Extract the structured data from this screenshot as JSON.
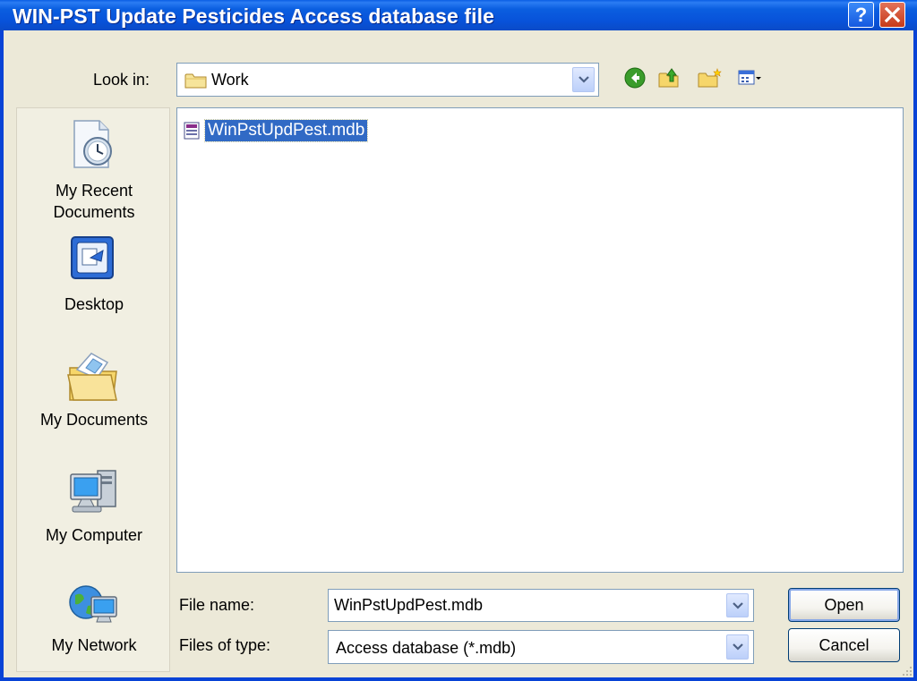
{
  "window": {
    "title": "WIN-PST Update Pesticides Access database file",
    "help_symbol": "?"
  },
  "look_in": {
    "label": "Look in:",
    "value": "Work"
  },
  "toolbar": {
    "icons": [
      "back-icon",
      "up-folder-icon",
      "new-folder-icon",
      "views-menu-icon"
    ]
  },
  "places_bar": {
    "items": [
      {
        "label_line1": "My Recent",
        "label_line2": "Documents",
        "icon": "recent-documents-icon"
      },
      {
        "label_line1": "Desktop",
        "label_line2": "",
        "icon": "desktop-icon"
      },
      {
        "label_line1": "My Documents",
        "label_line2": "",
        "icon": "my-documents-icon"
      },
      {
        "label_line1": "My Computer",
        "label_line2": "",
        "icon": "my-computer-icon"
      },
      {
        "label_line1": "My Network",
        "label_line2": "",
        "icon": "my-network-icon"
      }
    ]
  },
  "file_list": {
    "items": [
      {
        "name": "WinPstUpdPest.mdb",
        "selected": true,
        "icon": "access-database-icon"
      }
    ]
  },
  "file_name": {
    "label": "File name:",
    "value": "WinPstUpdPest.mdb"
  },
  "file_type": {
    "label": "Files of type:",
    "value": "Access database (*.mdb)"
  },
  "buttons": {
    "open": "Open",
    "cancel": "Cancel"
  },
  "colors": {
    "titlebar": "#0a5ee0",
    "selection": "#316ac5",
    "dialog_bg": "#ece9d8"
  }
}
